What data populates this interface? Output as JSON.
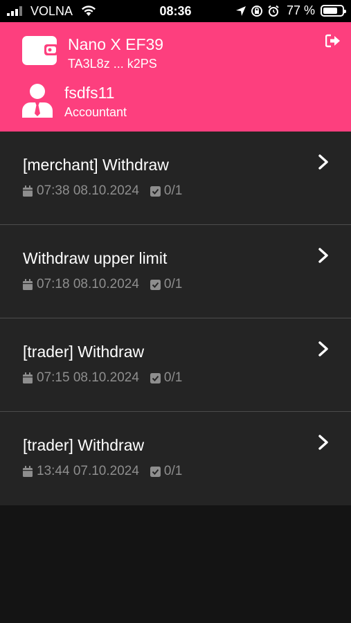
{
  "status_bar": {
    "carrier": "VOLNA",
    "time": "08:36",
    "battery": "77 %",
    "battery_level": 0.77
  },
  "header": {
    "device_name": "Nano X EF39",
    "device_address": "TA3L8z ... k2PS",
    "user_name": "fsdfs11",
    "user_role": "Accountant",
    "accent_color": "#fd3f7e"
  },
  "items": [
    {
      "title": "[merchant] Withdraw",
      "datetime": "07:38 08.10.2024",
      "count": "0/1"
    },
    {
      "title": "Withdraw upper limit",
      "datetime": "07:18 08.10.2024",
      "count": "0/1"
    },
    {
      "title": "[trader] Withdraw",
      "datetime": "07:15 08.10.2024",
      "count": "0/1"
    },
    {
      "title": "[trader] Withdraw",
      "datetime": "13:44 07.10.2024",
      "count": "0/1"
    }
  ]
}
